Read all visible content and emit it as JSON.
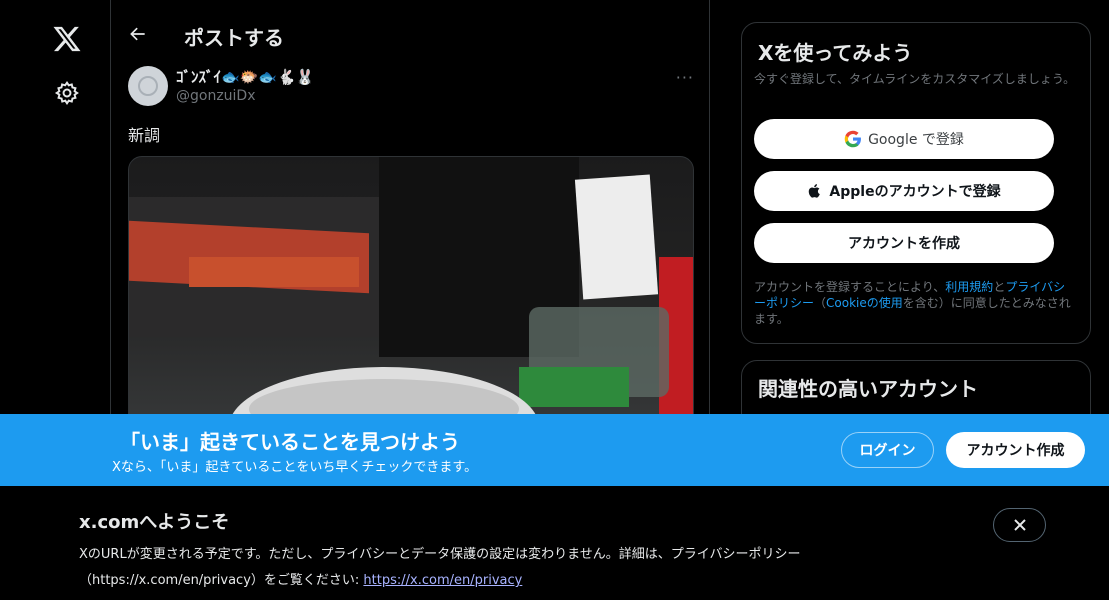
{
  "header": {
    "title": "ポストする"
  },
  "post": {
    "display_name": "ｺﾞﾝｽﾞｲ🐟🐡🐟🐇🐰",
    "handle": "@gonzuiDx",
    "more": "···",
    "text": "新調"
  },
  "sidebar": {
    "title": "Xを使ってみよう",
    "subtitle": "今すぐ登録して、タイムラインをカスタマイズしましょう。",
    "google_button": "Google で登録",
    "apple_button": "Appleのアカウントで登録",
    "create_button": "アカウントを作成",
    "terms_prefix": "アカウントを登録することにより、",
    "terms_link": "利用規約",
    "terms_and": "と",
    "privacy_link": "プライバシーポリシー",
    "terms_paren_open": "（",
    "cookie_link": "Cookieの使用",
    "terms_suffix": "を含む）に同意したとみなされます。"
  },
  "related": {
    "title": "関連性の高いアカウント"
  },
  "banner": {
    "title": "「いま」起きていることを見つけよう",
    "subtitle": "Xなら、「いま」起きていることをいち早くチェックできます。",
    "login": "ログイン",
    "signup": "アカウント作成"
  },
  "notice": {
    "title": "x.comへようこそ",
    "body": "XのURLが変更される予定です。ただし、プライバシーとデータ保護の設定は変わりません。詳細は、プライバシーポリシー（https://x.com/en/privacy）をご覧ください: ",
    "link": "https://x.com/en/privacy"
  },
  "colors": {
    "accent": "#1d9bf0",
    "background": "#000000"
  }
}
